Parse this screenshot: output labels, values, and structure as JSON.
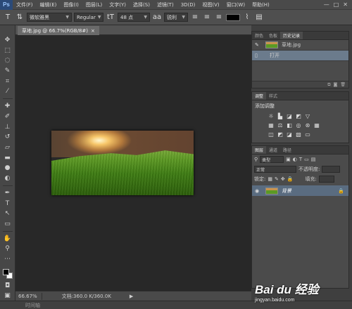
{
  "app": {
    "logo": "Ps"
  },
  "menu": [
    "文件(F)",
    "编辑(E)",
    "图像(I)",
    "图层(L)",
    "文字(Y)",
    "选择(S)",
    "滤镜(T)",
    "3D(D)",
    "视图(V)",
    "窗口(W)",
    "帮助(H)"
  ],
  "window_controls": [
    "—",
    "□",
    "✕"
  ],
  "options": {
    "font_family": "微软雅黑",
    "font_style": "Regular",
    "font_size": "48 点",
    "antialias": "锐利",
    "text_color": "#000000"
  },
  "document": {
    "tab_title": "草地.jpg @ 66.7%(RGB/8#)",
    "zoom": "66.67%",
    "doc_size": "文档:360.0 K/360.0K"
  },
  "timeline_label": "时间轴",
  "history_panel": {
    "tabs": [
      "颜色",
      "色板",
      "历史记录"
    ],
    "snapshot_name": "草地.jpg",
    "states": [
      "打开"
    ]
  },
  "adjustments_panel": {
    "tabs": [
      "调整",
      "样式"
    ],
    "title": "添加调整"
  },
  "layers_panel": {
    "tabs": [
      "图层",
      "通道",
      "路径"
    ],
    "filter": "类型",
    "blend_mode": "正常",
    "opacity_label": "不透明度:",
    "lock_label": "锁定:",
    "fill_label": "填充:",
    "layer_name": "背景"
  },
  "watermark": {
    "brand": "Bai du 经验",
    "url": "jingyan.baidu.com"
  }
}
